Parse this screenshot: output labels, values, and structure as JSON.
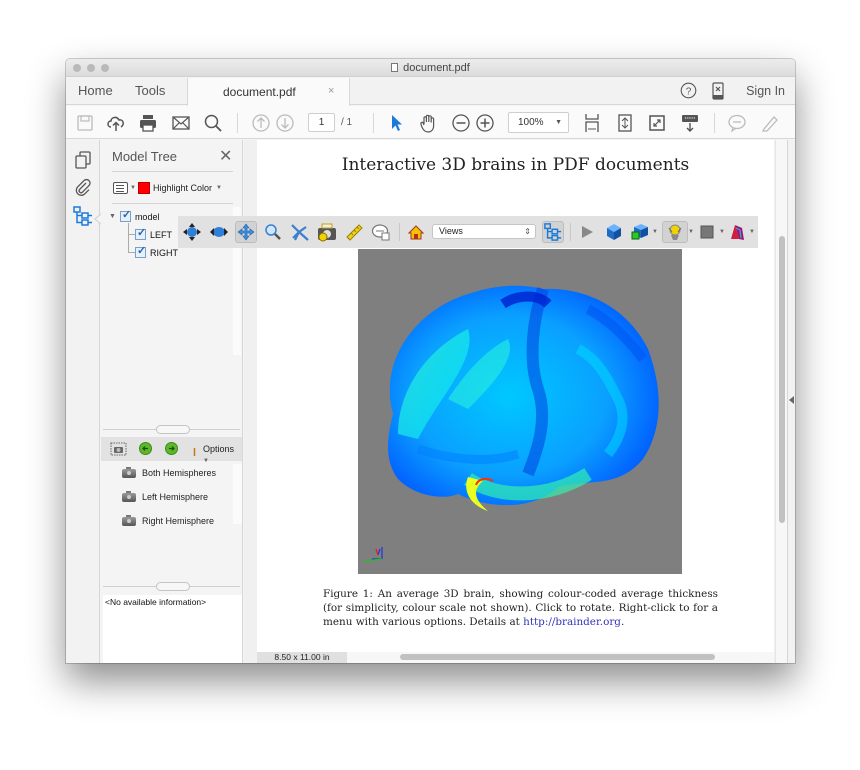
{
  "window": {
    "title": "document.pdf",
    "traffic_lights": [
      "close",
      "minimize",
      "zoom"
    ]
  },
  "tabbar": {
    "home": "Home",
    "tools": "Tools",
    "document_tab": "document.pdf",
    "close_tab": "×",
    "help_icon": "?",
    "sign_in": "Sign In"
  },
  "toolbar": {
    "buttons": [
      "save",
      "upload",
      "print",
      "email",
      "search",
      "previous-page",
      "next-page",
      "select",
      "hand",
      "zoom-out",
      "zoom-in",
      "fit-page",
      "rotate",
      "full-screen",
      "read-mode",
      "comment",
      "highlight"
    ],
    "page_current": "1",
    "page_total": "/ 1",
    "zoom_level": "100%"
  },
  "left_rail": {
    "items": [
      "pages",
      "attachments",
      "model-tree"
    ],
    "active": "model-tree",
    "active_color": "#1a7ad9"
  },
  "model_tree": {
    "title": "Model Tree",
    "highlight_label": "Highlight Color",
    "highlight_color": "#ff0000",
    "nodes": [
      {
        "label": "model",
        "checked": true,
        "level": 0,
        "expanded": true
      },
      {
        "label": "LEFT",
        "checked": true,
        "level": 1
      },
      {
        "label": "RIGHT",
        "checked": true,
        "level": 1
      }
    ],
    "options_label": "Options",
    "views": [
      {
        "label": "Both Hemispheres"
      },
      {
        "label": "Left Hemisphere"
      },
      {
        "label": "Right Hemisphere"
      }
    ],
    "info_text": "<No available information>"
  },
  "document": {
    "title": "Interactive 3D brains in PDF documents",
    "toolbar3d": {
      "tools": [
        "rotate",
        "spin",
        "pan",
        "zoom",
        "walk",
        "fly",
        "camera",
        "measure",
        "comment",
        "home",
        "model-tree",
        "play-animation",
        "projection",
        "render-mode",
        "lighting",
        "background-color",
        "cross-section"
      ],
      "active_tool": "pan",
      "views_select": "Views"
    },
    "caption_prefix": "Figure 1:  An average 3D brain, showing colour-coded average thickness (for simplicity, colour scale not shown).  Click to rotate.  Right-click to for a menu with various options.  Details at ",
    "caption_link": "http://brainder.org",
    "caption_suffix": ".",
    "page_size": "8.50 x 11.00 in",
    "viewer_background": "#7f7f7f"
  }
}
